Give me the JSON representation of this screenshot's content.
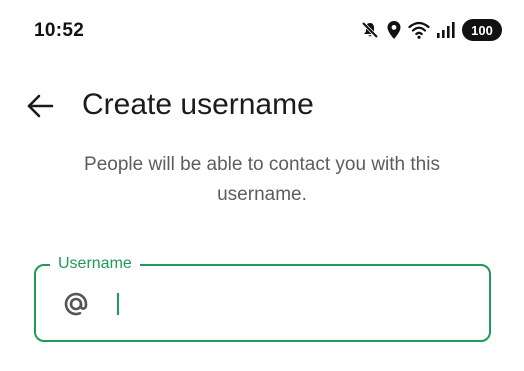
{
  "status_bar": {
    "time": "10:52",
    "icons": [
      "mute-icon",
      "location-icon",
      "wifi-icon",
      "signal-icon"
    ],
    "battery": "100"
  },
  "header": {
    "title": "Create username",
    "back_icon": "arrow-back-icon"
  },
  "description": "People will be able to contact you with this username.",
  "username_field": {
    "label": "Username",
    "prefix_icon": "at-sign-icon",
    "value": "",
    "accent_color": "#1f9b57"
  }
}
